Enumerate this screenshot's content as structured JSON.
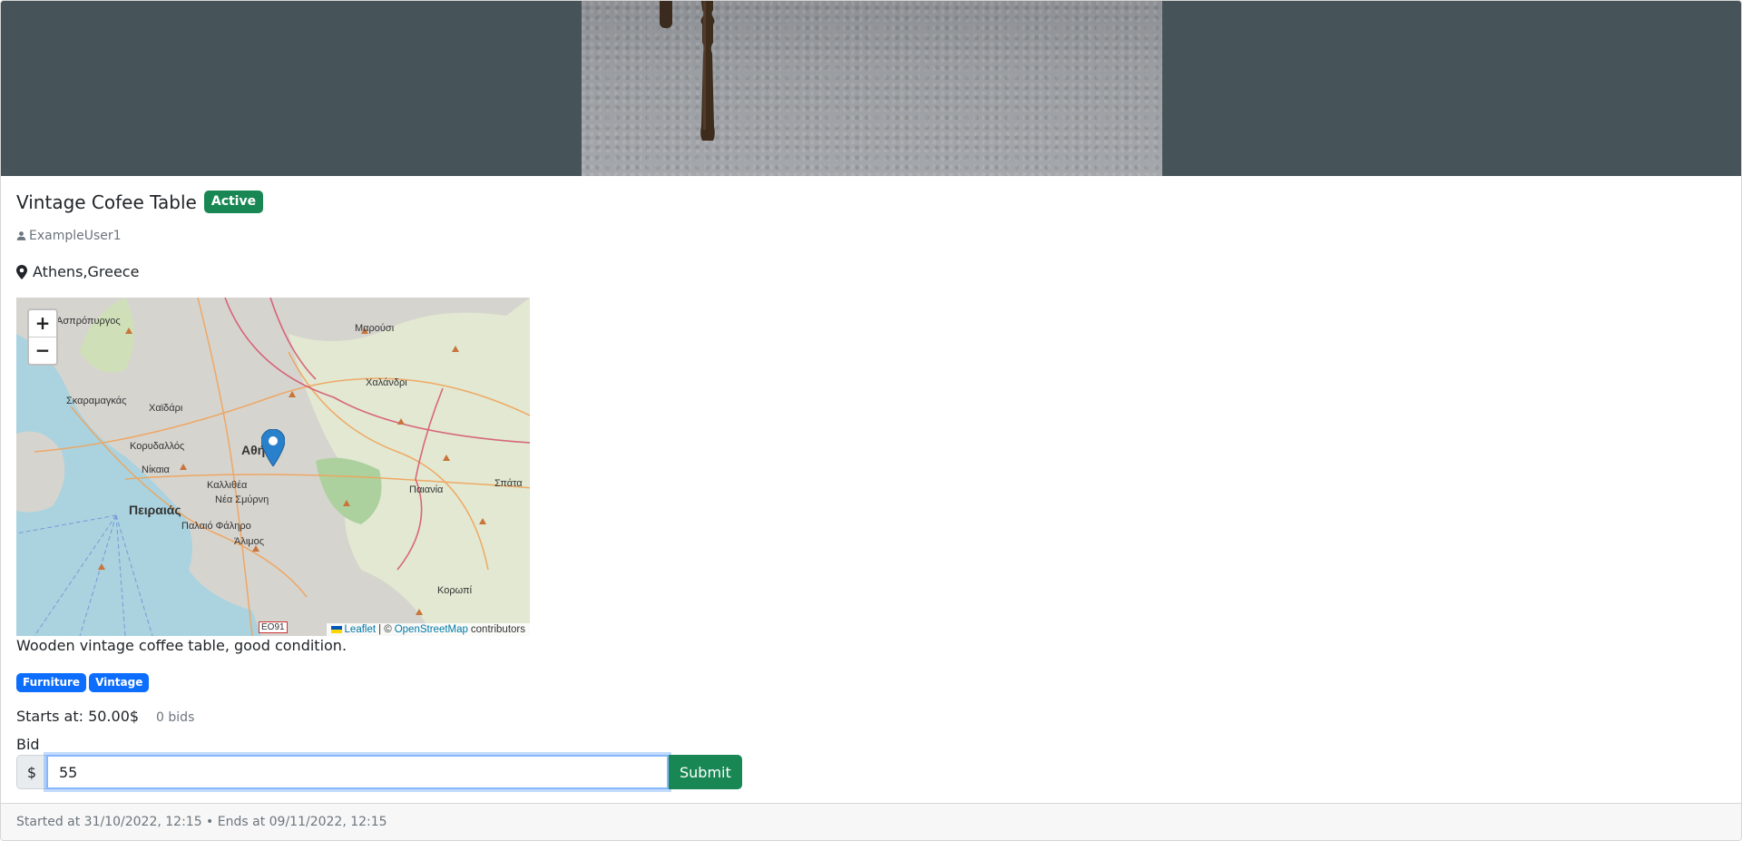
{
  "listing": {
    "title": "Vintage Cofee Table",
    "status": "Active",
    "seller": "ExampleUser1",
    "location": "Athens,Greece",
    "description": "Wooden vintage coffee table, good condition.",
    "tags": [
      "Furniture",
      "Vintage"
    ],
    "starts_at": "Starts at: 50.00$",
    "bids": "0 bids"
  },
  "map": {
    "zoom_in": "+",
    "zoom_out": "−",
    "attribution_leaflet": "Leaflet",
    "attribution_sep": "| ©",
    "attribution_osm": "OpenStreetMap",
    "attribution_tail": "contributors",
    "labels": {
      "athens": "Αθήνα",
      "piraeus": "Πειραιάς",
      "nikaia": "Νίκαια",
      "korydallos": "Κορυδαλλός",
      "chaidari": "Χαϊδάρι",
      "skaramagkas": "Σκαραμαγκάς",
      "kallithea": "Καλλιθέα",
      "nea_smyrni": "Νέα Σμύρνη",
      "palaio_faliro": "Παλαιό Φάληρο",
      "alimos": "Άλιμος",
      "marousi": "Μαρούσι",
      "chalandri": "Χαλάνδρι",
      "paiania": "Παιανία",
      "spata": "Σπάτα",
      "koropi": "Κορωπί",
      "aspropyrgos": "Ασπρόπυργος",
      "eo91": "ΕΟ91"
    }
  },
  "bid_form": {
    "label": "Bid",
    "prefix": "$",
    "value": "55",
    "submit": "Submit"
  },
  "footer": {
    "text": "Started at 31/10/2022, 12:15 • Ends at 09/11/2022, 12:15"
  },
  "colors": {
    "hero_bg": "#465358",
    "active_badge": "#198754",
    "tag": "#0d6efd",
    "submit": "#198754"
  }
}
